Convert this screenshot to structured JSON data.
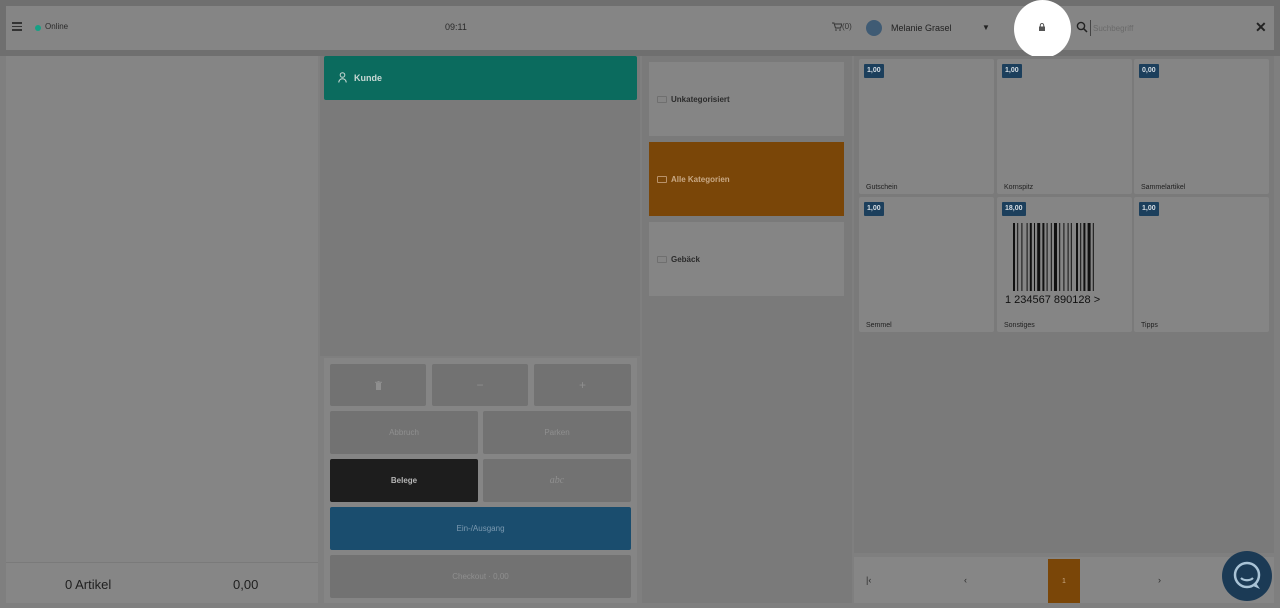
{
  "header": {
    "status_text": "Online",
    "clock": "09:11",
    "cart_count": "(0)",
    "user_name": "Melanie Grasel",
    "search_placeholder": "Suchbegriff"
  },
  "customer": {
    "label": "Kunde"
  },
  "cart": {
    "article_count": "0 Artikel",
    "total": "0,00"
  },
  "keypad": {
    "minus": "−",
    "plus": "+",
    "cancel": "Abbruch",
    "park": "Parken",
    "receipts": "Belege",
    "abc": "abc",
    "cash_in_out": "Ein-/Ausgang",
    "checkout": "Checkout · 0,00"
  },
  "categories": [
    {
      "label": "Unkategorisiert",
      "active": false
    },
    {
      "label": "Alle Kategorien",
      "active": true
    },
    {
      "label": "Gebäck",
      "active": false
    }
  ],
  "products": [
    {
      "name": "Gutschein",
      "price": "1,00"
    },
    {
      "name": "Kornspitz",
      "price": "1,00"
    },
    {
      "name": "Sammelartikel",
      "price": "0,00"
    },
    {
      "name": "Semmel",
      "price": "1,00"
    },
    {
      "name": "Sonstiges",
      "price": "18,00",
      "barcode": "1  234567  890128  >"
    },
    {
      "name": "Tipps",
      "price": "1,00"
    }
  ],
  "pager": {
    "first": "|‹",
    "prev": "‹",
    "current": "1",
    "next": "›"
  },
  "colors": {
    "accent_teal": "#16a085",
    "customer_button": "#0b6b5e",
    "active_category": "#7a4608",
    "price_badge": "#1c3f5c",
    "cash_button": "#1a4d6e"
  },
  "icons": {
    "menu": "menu-icon",
    "cart": "cart-icon",
    "lock": "lock-icon",
    "search": "search-icon",
    "close": "close-icon",
    "customer": "user-icon",
    "trash": "trash-icon",
    "chat": "chat-icon"
  }
}
